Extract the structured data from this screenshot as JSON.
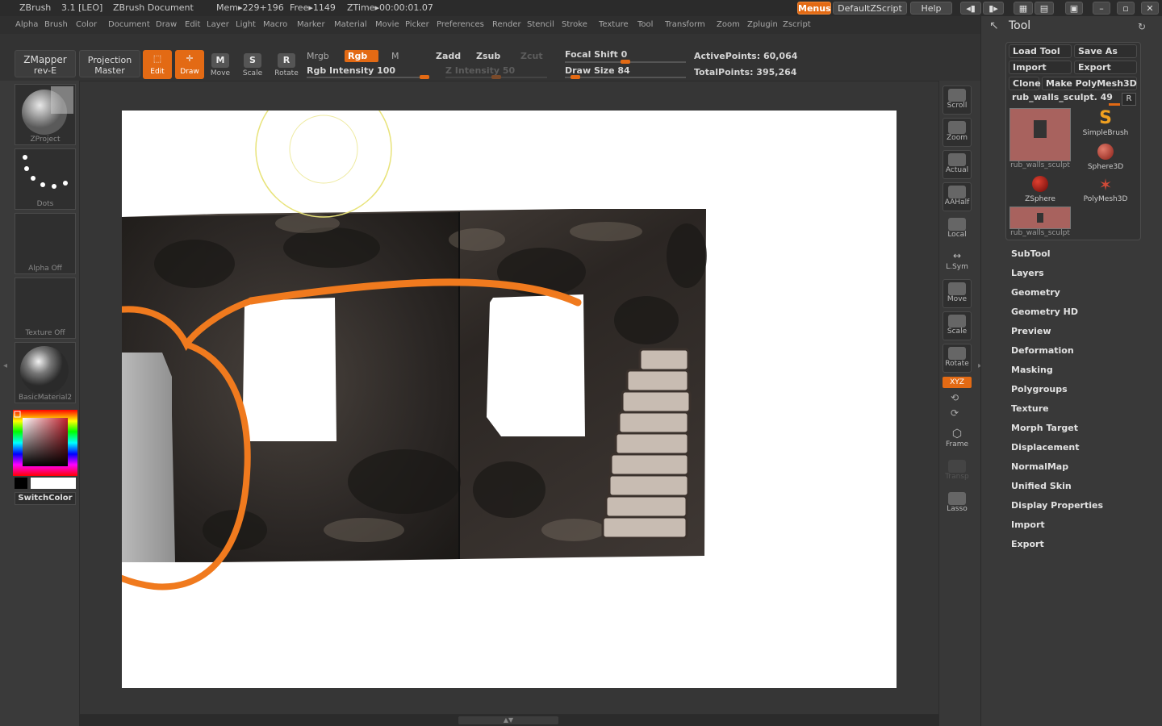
{
  "titlebar": {
    "app": "ZBrush",
    "version": "3.1 [LEO]",
    "document": "ZBrush Document",
    "mem": "Mem▸229+196",
    "free": "Free▸1149",
    "ztime": "ZTime▸00:00:01.07",
    "menus_label": "Menus",
    "script_label": "DefaultZScript",
    "help_label": "Help"
  },
  "menubar": {
    "items": [
      "Alpha",
      "Brush",
      "Color",
      "Document",
      "Draw",
      "Edit",
      "Layer",
      "Light",
      "Macro",
      "Marker",
      "Material",
      "Movie",
      "Picker",
      "Preferences",
      "Render",
      "Stencil",
      "Stroke",
      "Texture",
      "Tool",
      "Transform",
      "Zoom",
      "Zplugin",
      "Zscript"
    ]
  },
  "toolbar": {
    "zmapper_line1": "ZMapper",
    "zmapper_line2": "rev-E",
    "projection_line1": "Projection",
    "projection_line2": "Master",
    "edit": "Edit",
    "draw": "Draw",
    "move": "Move",
    "scale": "Scale",
    "rotate": "Rotate",
    "mrgb": "Mrgb",
    "rgb": "Rgb",
    "m": "M",
    "rgb_intensity": "Rgb Intensity 100",
    "zadd": "Zadd",
    "zsub": "Zsub",
    "zcut": "Zcut",
    "z_intensity": "Z Intensity 50",
    "focal_shift": "Focal Shift 0",
    "draw_size": "Draw Size 84",
    "active_points": "ActivePoints: 60,064",
    "total_points": "TotalPoints: 395,264",
    "rgb_intensity_value": 100,
    "z_intensity_value": 50,
    "focal_shift_value": 0,
    "draw_size_value": 84
  },
  "leftshelf": {
    "zproject": "ZProject",
    "dots": "Dots",
    "alpha": "Alpha Off",
    "texture": "Texture Off",
    "material": "BasicMaterial2",
    "switchcolor": "SwitchColor"
  },
  "rightshelf": {
    "items": [
      "Scroll",
      "Zoom",
      "Actual",
      "AAHalf",
      "Local",
      "L.Sym",
      "Move",
      "Scale",
      "Rotate",
      "XYZ",
      "Frame",
      "Transp",
      "Lasso"
    ]
  },
  "tool": {
    "title": "Tool",
    "load_tool": "Load Tool",
    "save_as": "Save As",
    "import": "Import",
    "export": "Export",
    "clone": "Clone",
    "make_polymesh": "Make PolyMesh3D",
    "current_tool": "rub_walls_sculpt. 49",
    "r_label": "R",
    "thumbs": [
      {
        "name": "rub_walls_sculpt"
      },
      {
        "name": "SimpleBrush"
      },
      {
        "name": "Sphere3D"
      },
      {
        "name": "ZSphere"
      },
      {
        "name": "PolyMesh3D"
      },
      {
        "name": "rub_walls_sculpt"
      }
    ],
    "subpalettes": [
      "SubTool",
      "Layers",
      "Geometry",
      "Geometry HD",
      "Preview",
      "Deformation",
      "Masking",
      "Polygroups",
      "Texture",
      "Morph Target",
      "Displacement",
      "NormalMap",
      "Unified Skin",
      "Display Properties",
      "Import",
      "Export"
    ]
  },
  "colors": {
    "accent": "#e36a14",
    "panel": "#393939",
    "canvas": "#ffffff",
    "annotation": "#f07a1e",
    "brush_cursor": "#e8e37a"
  }
}
